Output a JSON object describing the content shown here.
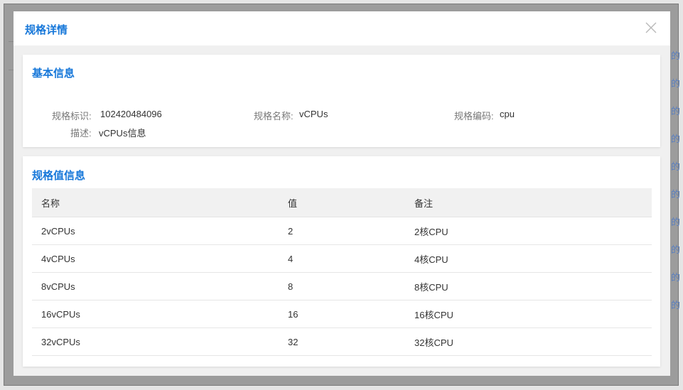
{
  "background": {
    "links": [
      "的",
      "的",
      "的",
      "的",
      "的",
      "的",
      "的",
      "的",
      "的",
      "的"
    ]
  },
  "modal": {
    "title": "规格详情",
    "close_label": "×"
  },
  "basic_info": {
    "section_title": "基本信息",
    "fields": [
      {
        "label": "规格标识:",
        "value": "102420484096"
      },
      {
        "label": "规格名称:",
        "value": "vCPUs"
      },
      {
        "label": "规格编码:",
        "value": "cpu"
      },
      {
        "label": "描述:",
        "value": "vCPUs信息"
      }
    ]
  },
  "values_info": {
    "section_title": "规格值信息",
    "columns": [
      "名称",
      "值",
      "备注"
    ],
    "rows": [
      [
        "2vCPUs",
        "2",
        "2核CPU"
      ],
      [
        "4vCPUs",
        "4",
        "4核CPU"
      ],
      [
        "8vCPUs",
        "8",
        "8核CPU"
      ],
      [
        "16vCPUs",
        "16",
        "16核CPU"
      ],
      [
        "32vCPUs",
        "32",
        "32核CPU"
      ]
    ]
  }
}
